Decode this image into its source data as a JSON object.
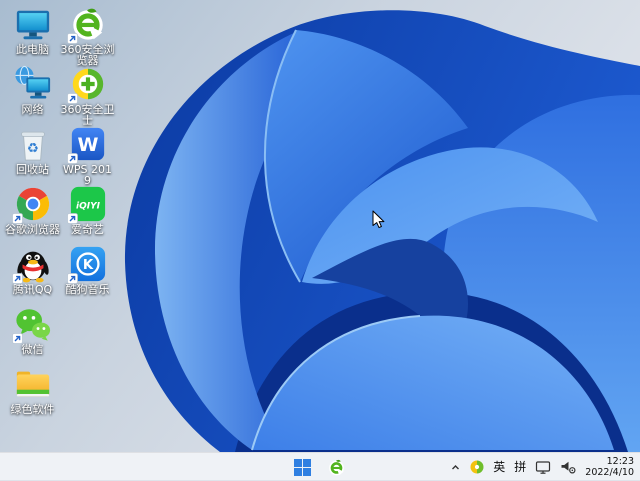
{
  "desktop": {
    "icons": [
      {
        "id": "this-pc",
        "label": "此电脑",
        "shortcut": false,
        "col": 0,
        "row": 0
      },
      {
        "id": "browser-360",
        "label": "360安全浏览器",
        "shortcut": true,
        "col": 1,
        "row": 0
      },
      {
        "id": "network",
        "label": "网络",
        "shortcut": false,
        "col": 0,
        "row": 1
      },
      {
        "id": "safety-360",
        "label": "360安全卫士",
        "shortcut": true,
        "col": 1,
        "row": 1
      },
      {
        "id": "recycle-bin",
        "label": "回收站",
        "shortcut": false,
        "col": 0,
        "row": 2
      },
      {
        "id": "wps",
        "label": "WPS 2019",
        "shortcut": true,
        "col": 1,
        "row": 2
      },
      {
        "id": "chrome",
        "label": "谷歌浏览器",
        "shortcut": true,
        "col": 0,
        "row": 3
      },
      {
        "id": "iqiyi",
        "label": "爱奇艺",
        "shortcut": true,
        "col": 1,
        "row": 3
      },
      {
        "id": "qq",
        "label": "腾讯QQ",
        "shortcut": true,
        "col": 0,
        "row": 4
      },
      {
        "id": "kugou",
        "label": "酷狗音乐",
        "shortcut": true,
        "col": 1,
        "row": 4
      },
      {
        "id": "wechat",
        "label": "微信",
        "shortcut": true,
        "col": 0,
        "row": 5
      },
      {
        "id": "software-folder",
        "label": "绿色软件",
        "shortcut": false,
        "col": 0,
        "row": 6
      }
    ]
  },
  "taskbar": {
    "tray": {
      "ime_language": "英",
      "ime_layout": "拼",
      "time": "12:23",
      "date": "2022/4/10"
    }
  },
  "colors": {
    "taskbar_bg": "#eff2f6",
    "bloom_dark_blue": "#0a2f8e",
    "bloom_bright_blue": "#4f94f0",
    "desktop_light": "#dfe3ea"
  }
}
